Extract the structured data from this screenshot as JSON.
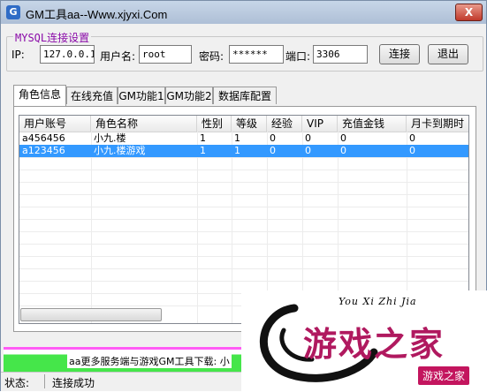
{
  "window": {
    "title": "GM工具aa--Www.xjyxi.Com",
    "close_label": "X"
  },
  "connection": {
    "group_label": "MYSQL连接设置",
    "ip_label": "IP:",
    "ip_value": "127.0.0.1",
    "user_label": "用户名:",
    "user_value": "root",
    "password_label": "密码:",
    "password_value": "******",
    "port_label": "端口:",
    "port_value": "3306",
    "connect_label": "连接",
    "exit_label": "退出"
  },
  "tabs": [
    {
      "label": "角色信息",
      "active": true
    },
    {
      "label": "在线充值",
      "active": false
    },
    {
      "label": "GM功能1",
      "active": false
    },
    {
      "label": "GM功能2",
      "active": false
    },
    {
      "label": "数据库配置",
      "active": false
    }
  ],
  "table": {
    "columns": [
      "用户账号",
      "角色名称",
      "性别",
      "等级",
      "经验",
      "VIP",
      "充值金钱",
      "月卡到期时"
    ],
    "rows": [
      [
        "a456456",
        "小九.楼",
        "1",
        "1",
        "0",
        "0",
        "0",
        "0"
      ],
      [
        "a123456",
        "小九.楼游戏",
        "1",
        "1",
        "0",
        "0",
        "0",
        "0"
      ]
    ],
    "selected_row": 1
  },
  "banner": {
    "text": "aa更多服务端与游戏GM工具下载: 小"
  },
  "status": {
    "label": "状态:",
    "value": "连接成功"
  },
  "watermark": {
    "tagline": "You Xi Zhi Jia",
    "main": "游戏之家",
    "badge": "游戏之家"
  },
  "colors": {
    "accent_purple": "#8a0aa8",
    "selection": "#3399ff",
    "watermark": "#b0195f"
  }
}
